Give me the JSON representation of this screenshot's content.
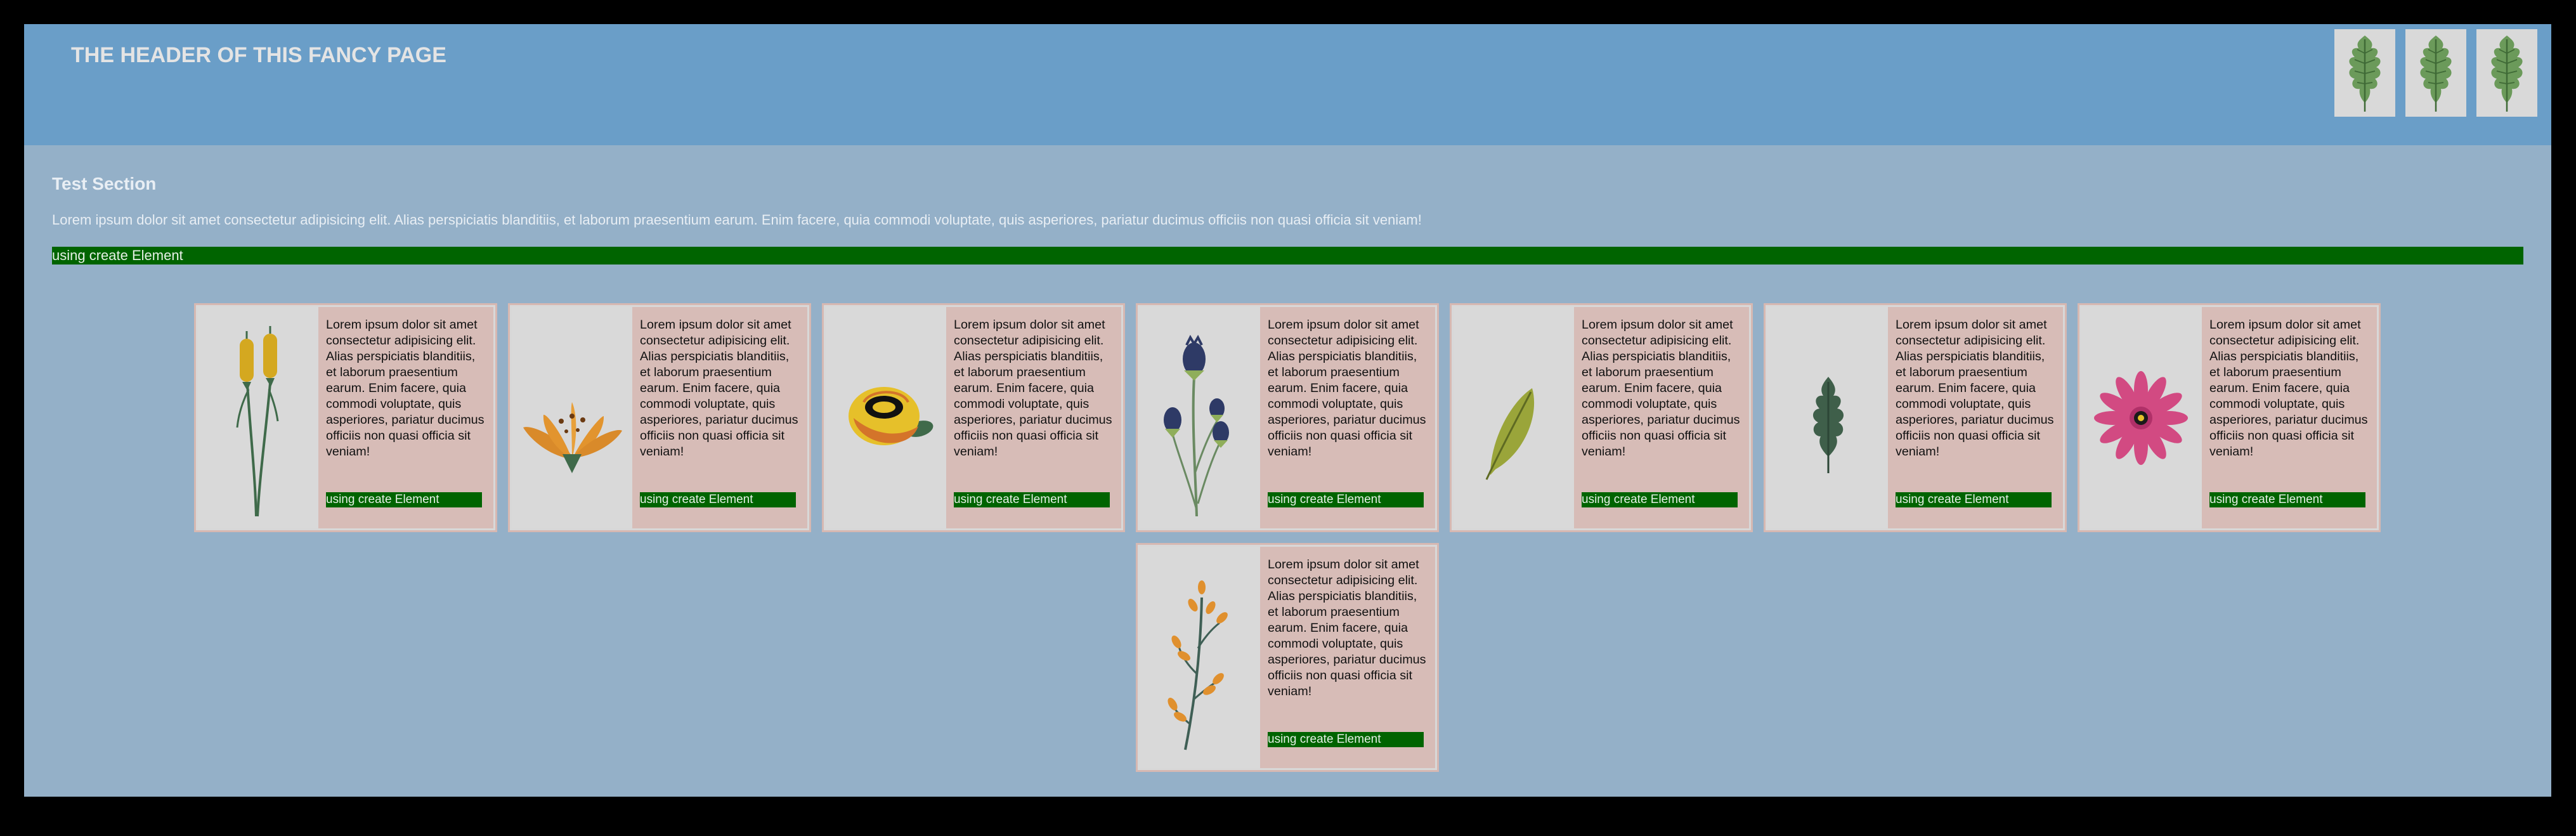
{
  "header": {
    "title": "THE HEADER OF THIS FANCY PAGE",
    "icons": [
      "oak-leaf-icon",
      "oak-leaf-icon",
      "oak-leaf-icon"
    ]
  },
  "section": {
    "title": "Test Section",
    "text": "Lorem ipsum dolor sit amet consectetur adipisicing elit. Alias perspiciatis blanditiis, et laborum praesentium earum. Enim facere, quia commodi voluptate, quis asperiores, pariatur ducimus officiis non quasi officia sit veniam!",
    "bar_label": "using create Element"
  },
  "cards": [
    {
      "image": "cattail-plant",
      "text": "Lorem ipsum dolor sit amet consectetur adipisicing elit. Alias perspiciatis blanditiis, et laborum praesentium earum. Enim facere, quia commodi voluptate, quis asperiores, pariatur ducimus officiis non quasi officia sit veniam!",
      "button": "using create Element"
    },
    {
      "image": "orange-lily-flower",
      "text": "Lorem ipsum dolor sit amet consectetur adipisicing elit. Alias perspiciatis blanditiis, et laborum praesentium earum. Enim facere, quia commodi voluptate, quis asperiores, pariatur ducimus officiis non quasi officia sit veniam!",
      "button": "using create Element"
    },
    {
      "image": "yellow-rose-flower",
      "text": "Lorem ipsum dolor sit amet consectetur adipisicing elit. Alias perspiciatis blanditiis, et laborum praesentium earum. Enim facere, quia commodi voluptate, quis asperiores, pariatur ducimus officiis non quasi officia sit veniam!",
      "button": "using create Element"
    },
    {
      "image": "blue-thistle-plant",
      "text": "Lorem ipsum dolor sit amet consectetur adipisicing elit. Alias perspiciatis blanditiis, et laborum praesentium earum. Enim facere, quia commodi voluptate, quis asperiores, pariatur ducimus officiis non quasi officia sit veniam!",
      "button": "using create Element"
    },
    {
      "image": "olive-leaf",
      "text": "Lorem ipsum dolor sit amet consectetur adipisicing elit. Alias perspiciatis blanditiis, et laborum praesentium earum. Enim facere, quia commodi voluptate, quis asperiores, pariatur ducimus officiis non quasi officia sit veniam!",
      "button": "using create Element"
    },
    {
      "image": "dark-oak-leaf",
      "text": "Lorem ipsum dolor sit amet consectetur adipisicing elit. Alias perspiciatis blanditiis, et laborum praesentium earum. Enim facere, quia commodi voluptate, quis asperiores, pariatur ducimus officiis non quasi officia sit veniam!",
      "button": "using create Element"
    },
    {
      "image": "pink-daisy-flower",
      "text": "Lorem ipsum dolor sit amet consectetur adipisicing elit. Alias perspiciatis blanditiis, et laborum praesentium earum. Enim facere, quia commodi voluptate, quis asperiores, pariatur ducimus officiis non quasi officia sit veniam!",
      "button": "using create Element"
    },
    {
      "image": "orange-berry-branch",
      "text": "Lorem ipsum dolor sit amet consectetur adipisicing elit. Alias perspiciatis blanditiis, et laborum praesentium earum. Enim facere, quia commodi voluptate, quis asperiores, pariatur ducimus officiis non quasi officia sit veniam!",
      "button": "using create Element"
    }
  ],
  "colors": {
    "header_bg": "#6a9ec8",
    "page_bg": "#94b0c8",
    "green": "#006400",
    "card_text_bg": "#d7bcb7"
  }
}
